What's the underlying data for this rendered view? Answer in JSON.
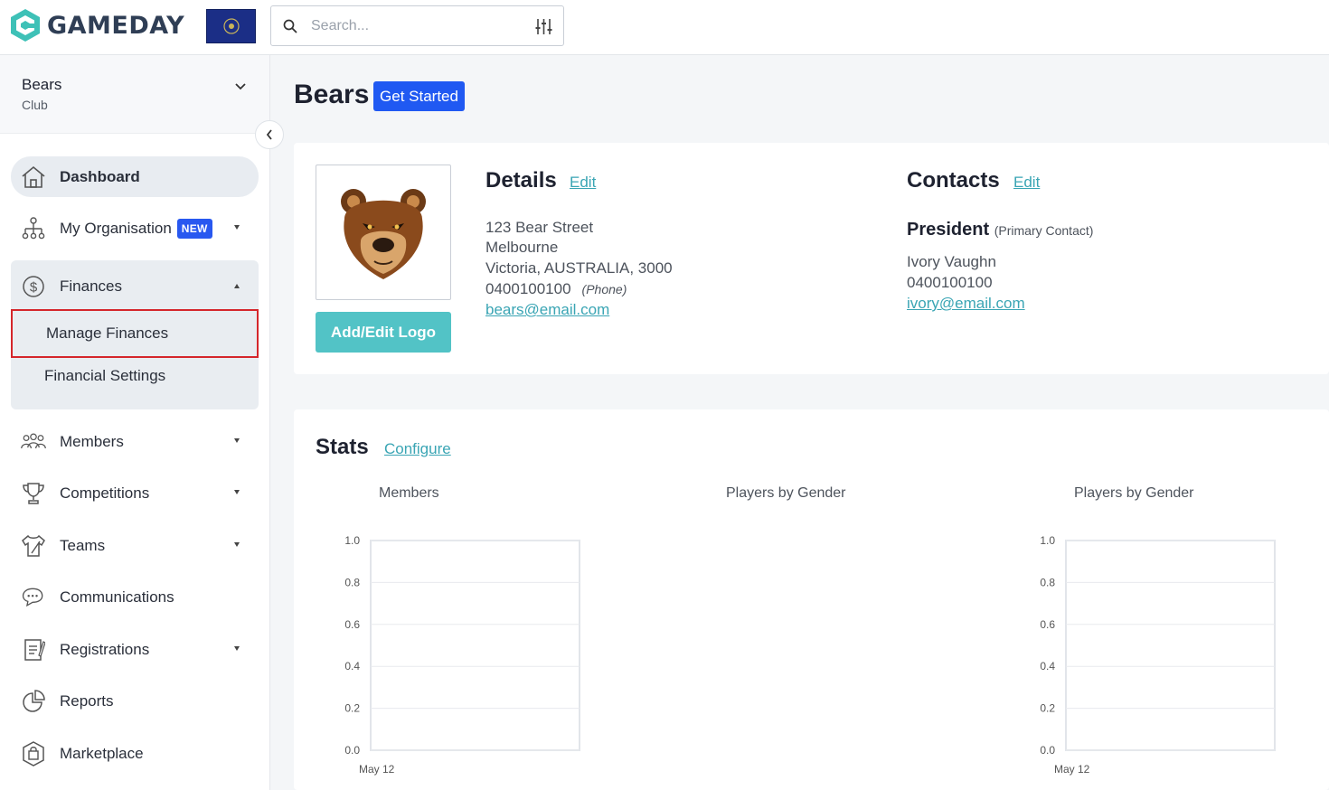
{
  "brand": {
    "name": "GAMEDAY"
  },
  "search": {
    "placeholder": "Search..."
  },
  "org": {
    "name": "Bears",
    "type": "Club"
  },
  "nav": {
    "dashboard": "Dashboard",
    "my_organisation": "My Organisation",
    "new_badge": "NEW",
    "finances": "Finances",
    "manage_finances": "Manage Finances",
    "financial_settings": "Financial Settings",
    "members": "Members",
    "competitions": "Competitions",
    "teams": "Teams",
    "communications": "Communications",
    "registrations": "Registrations",
    "reports": "Reports",
    "marketplace": "Marketplace"
  },
  "header": {
    "title": "Bears",
    "get_started": "Get Started"
  },
  "details": {
    "title": "Details",
    "edit": "Edit",
    "street": "123 Bear Street",
    "city": "Melbourne",
    "region": "Victoria,  AUSTRALIA,  3000",
    "phone": "0400100100",
    "phone_tag": "(Phone)",
    "email": "bears@email.com",
    "logo_button": "Add/Edit Logo"
  },
  "contacts": {
    "title": "Contacts",
    "edit": "Edit",
    "role": "President",
    "role_note": "(Primary Contact)",
    "name": "Ivory Vaughn",
    "phone": "0400100100",
    "email": "ivory@email.com"
  },
  "stats": {
    "title": "Stats",
    "configure": "Configure"
  },
  "chart_data": [
    {
      "type": "line",
      "title": "Members",
      "x": [
        "May 12"
      ],
      "series": [],
      "ylim": [
        0,
        1.0
      ],
      "yticks": [
        "1.0",
        "0.8",
        "0.6",
        "0.4",
        "0.2",
        "0.0"
      ],
      "grid": true
    },
    {
      "type": "pie",
      "title": "Players by Gender",
      "series": []
    },
    {
      "type": "line",
      "title": "Players by Gender",
      "x": [
        "May 12"
      ],
      "series": [],
      "ylim": [
        0,
        1.0
      ],
      "yticks": [
        "1.0",
        "0.8",
        "0.6",
        "0.4",
        "0.2",
        "0.0"
      ],
      "grid": true
    }
  ],
  "colors": {
    "accent": "#2059f2",
    "teal": "#52c3c6",
    "link": "#3aa5b4",
    "highlight": "#d5262b"
  }
}
